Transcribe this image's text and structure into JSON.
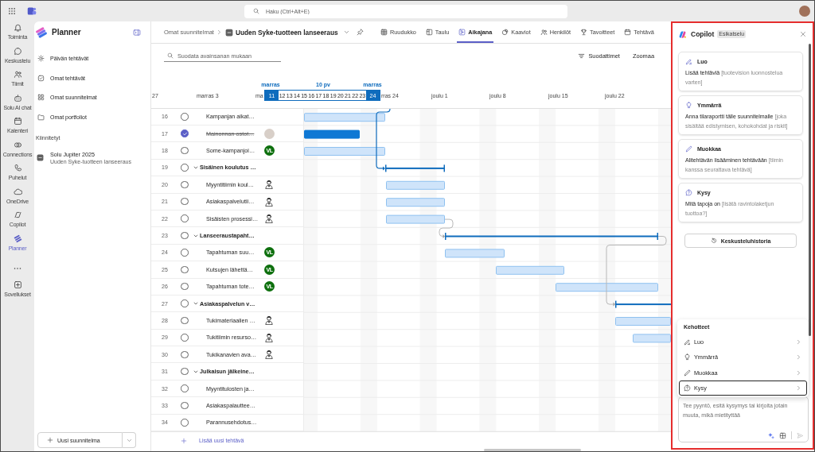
{
  "top_bar": {
    "search": {
      "placeholder": "Haku (Ctrl+Alt+E)"
    }
  },
  "app_rail": {
    "items": [
      {
        "label": "Toiminta",
        "selected": false
      },
      {
        "label": "Keskustelu",
        "selected": false
      },
      {
        "label": "Tiimit",
        "selected": false
      },
      {
        "label": "Solu AI chat",
        "selected": false
      },
      {
        "label": "Kalenteri",
        "selected": false
      },
      {
        "label": "Connections",
        "selected": false
      },
      {
        "label": "Puhelut",
        "selected": false
      },
      {
        "label": "OneDrive",
        "selected": false
      },
      {
        "label": "Copilot",
        "selected": false
      },
      {
        "label": "Planner",
        "selected": true
      }
    ],
    "apps": {
      "label": "Sovellukset"
    }
  },
  "sidebar": {
    "title": "Planner",
    "nav": [
      {
        "label": "Päivän tehtävät",
        "selected": false
      },
      {
        "label": "Omat tehtävät",
        "selected": false
      },
      {
        "label": "Omat suunnitelmat",
        "selected": false
      },
      {
        "label": "Omat portfoliot",
        "selected": false
      }
    ],
    "pinned_heading": "Kiinnitetyt",
    "pinned": [
      {
        "title": "Solu Jupiter 2025",
        "subtitle": "Uuden Syke-tuotteen lanseeraus"
      }
    ],
    "new_plan_button": "Uusi suunnitelma"
  },
  "plan_header": {
    "breadcrumb": "Omat suunnitelmat",
    "title": "Uuden Syke-tuotteen lanseeraus",
    "tabs": [
      {
        "label": "Ruudukko",
        "selected": false
      },
      {
        "label": "Taulu",
        "selected": false
      },
      {
        "label": "Aikajana",
        "selected": true
      },
      {
        "label": "Kaaviot",
        "selected": false
      },
      {
        "label": "Henkilöt",
        "selected": false
      },
      {
        "label": "Tavoitteet",
        "selected": false
      },
      {
        "label": "Tehtävä",
        "selected": false
      }
    ]
  },
  "toolbar": {
    "filter": {
      "placeholder": "Suodata avainsanan mukaan"
    },
    "filters_button": "Suodattimet",
    "zoom_button": "Zoomaa"
  },
  "timeline": {
    "range": {
      "start_month": "marras",
      "start_day": "11",
      "length": "10 pv",
      "end_month": "marras",
      "end_day": "24",
      "days": [
        "12",
        "13",
        "14",
        "15",
        "16",
        "17",
        "18",
        "19",
        "20",
        "21",
        "22",
        "23"
      ]
    },
    "ticks": [
      "27",
      "marras 3",
      "ma",
      "rras 24",
      "joulu 1",
      "joulu 8",
      "joulu 15",
      "joulu 22"
    ]
  },
  "tasks": [
    {
      "number": "16",
      "kind": "task",
      "checked": false,
      "title": "Kampanjan aikat…"
    },
    {
      "number": "17",
      "kind": "task",
      "checked": true,
      "title": "Mainonnan ostot…",
      "assignee": {
        "kind": "photo"
      }
    },
    {
      "number": "18",
      "kind": "task",
      "checked": false,
      "title": "Some-kampanjoi…",
      "assignee": {
        "kind": "initials",
        "initials": "VL"
      }
    },
    {
      "number": "19",
      "kind": "group",
      "checked": false,
      "expanded": true,
      "title": "Sisäinen koulutus …"
    },
    {
      "number": "20",
      "kind": "task",
      "checked": false,
      "title": "Myyntitiimin koul…",
      "assignee": {
        "kind": "person"
      }
    },
    {
      "number": "21",
      "kind": "task",
      "checked": false,
      "title": "Asiakaspalvelutii…",
      "assignee": {
        "kind": "person"
      }
    },
    {
      "number": "22",
      "kind": "task",
      "checked": false,
      "title": "Sisäisten prosessi…",
      "assignee": {
        "kind": "person"
      }
    },
    {
      "number": "23",
      "kind": "group",
      "checked": false,
      "expanded": true,
      "title": "Lanseeraustapaht…"
    },
    {
      "number": "24",
      "kind": "task",
      "checked": false,
      "title": "Tapahtuman suu…",
      "assignee": {
        "kind": "initials",
        "initials": "VL"
      }
    },
    {
      "number": "25",
      "kind": "task",
      "checked": false,
      "title": "Kutsujen lähettä…",
      "assignee": {
        "kind": "initials",
        "initials": "VL"
      }
    },
    {
      "number": "26",
      "kind": "task",
      "checked": false,
      "title": "Tapahtuman tote…",
      "assignee": {
        "kind": "initials",
        "initials": "VL"
      }
    },
    {
      "number": "27",
      "kind": "group",
      "checked": false,
      "expanded": true,
      "title": "Asiakaspalvelun v…"
    },
    {
      "number": "28",
      "kind": "task",
      "checked": false,
      "title": "Tukimateriaalien …",
      "assignee": {
        "kind": "person"
      }
    },
    {
      "number": "29",
      "kind": "task",
      "checked": false,
      "title": "Tukitiimin resurso…",
      "assignee": {
        "kind": "person"
      }
    },
    {
      "number": "30",
      "kind": "task",
      "checked": false,
      "title": "Tukikanavien ava…",
      "assignee": {
        "kind": "person"
      }
    },
    {
      "number": "31",
      "kind": "group",
      "checked": false,
      "expanded": true,
      "title": "Julkaisun jälkeine…"
    },
    {
      "number": "32",
      "kind": "task",
      "checked": false,
      "title": "Myyntitulosten ja…"
    },
    {
      "number": "33",
      "kind": "task",
      "checked": false,
      "title": "Asiakaspalauttee…"
    },
    {
      "number": "34",
      "kind": "task",
      "checked": false,
      "title": "Parannusehdotus…"
    }
  ],
  "add_task": "Lisää uusi tehtävä",
  "copilot": {
    "title": "Copilot",
    "badge": "Esikatselu",
    "cards": [
      {
        "title": "Luo",
        "text": "Lisää tehtäviä",
        "hint": "[tuotevision luonnostelua varten]"
      },
      {
        "title": "Ymmärrä",
        "text": "Anna tilaraportti tälle suunnitelmalle",
        "hint": "[joka sisältää edistymisen, kohokohdat ja riskit]"
      },
      {
        "title": "Muokkaa",
        "text": "Alitehtävän lisääminen tehtävään",
        "hint": "[tiimin kanssa seurattava tehtävä]"
      },
      {
        "title": "Kysy",
        "text": "Mitä tapoja on",
        "hint": "[lisätä ravintolaketjun tuottoa?]"
      }
    ],
    "history_button": "Keskusteluhistoria",
    "prompts": {
      "heading": "Kehotteet",
      "items": [
        {
          "label": "Luo",
          "selected": false
        },
        {
          "label": "Ymmärrä",
          "selected": false
        },
        {
          "label": "Muokkaa",
          "selected": false
        },
        {
          "label": "Kysy",
          "selected": true
        }
      ]
    },
    "input": {
      "placeholder": "Tee pyyntö, esitä kysymys tai kirjoita jotain muuta, mikä mietityttää"
    }
  }
}
